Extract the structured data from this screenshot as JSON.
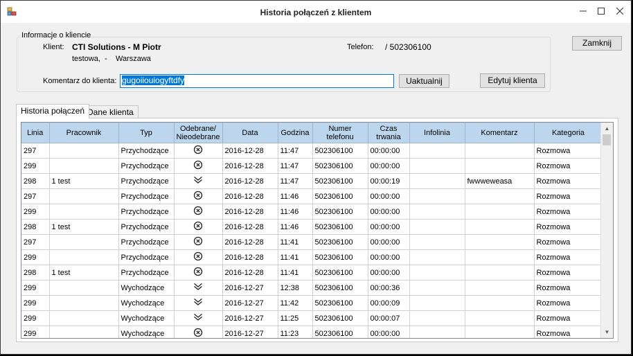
{
  "window": {
    "title": "Historia połączeń z klientem"
  },
  "client_info": {
    "group_label": "Informacje o kliencie",
    "client_label": "Klient:",
    "client_name": "CTI Solutions - M Piotr",
    "address": "testowa,  -    Warszawa",
    "phone_label": "Telefon:",
    "phone_value": "/ 502306100",
    "comment_label": "Komentarz do klienta:",
    "comment_value": "gugoiiouiogyftdfy"
  },
  "buttons": {
    "close": "Zamknij",
    "update": "Uaktualnij",
    "edit_client": "Edytuj klienta"
  },
  "tabs": [
    {
      "label": "Historia połączeń"
    },
    {
      "label": "Dane klienta"
    }
  ],
  "grid": {
    "columns": [
      {
        "label": "Linia"
      },
      {
        "label": "Pracownik"
      },
      {
        "label": "Typ"
      },
      {
        "label": "Odebrane/ Nieodebrane"
      },
      {
        "label": "Data"
      },
      {
        "label": "Godzina"
      },
      {
        "label": "Numer telefonu"
      },
      {
        "label": "Czas trwania"
      },
      {
        "label": "Infolinia"
      },
      {
        "label": "Komentarz"
      },
      {
        "label": "Kategoria"
      }
    ],
    "rows": [
      {
        "line": "297",
        "employee": "",
        "type": "Przychodzące",
        "status": "missed",
        "date": "2016-12-28",
        "time": "11:47",
        "phone": "502306100",
        "duration": "00:00:00",
        "hotline": "",
        "comment": "",
        "category": "Rozmowa"
      },
      {
        "line": "299",
        "employee": "",
        "type": "Przychodzące",
        "status": "missed",
        "date": "2016-12-28",
        "time": "11:47",
        "phone": "502306100",
        "duration": "00:00:00",
        "hotline": "",
        "comment": "",
        "category": "Rozmowa"
      },
      {
        "line": "298",
        "employee": "1 test",
        "type": "Przychodzące",
        "status": "answered",
        "date": "2016-12-28",
        "time": "11:47",
        "phone": "502306100",
        "duration": "00:00:19",
        "hotline": "",
        "comment": "fwwweweasa",
        "category": "Rozmowa"
      },
      {
        "line": "297",
        "employee": "",
        "type": "Przychodzące",
        "status": "missed",
        "date": "2016-12-28",
        "time": "11:46",
        "phone": "502306100",
        "duration": "00:00:00",
        "hotline": "",
        "comment": "",
        "category": "Rozmowa"
      },
      {
        "line": "299",
        "employee": "",
        "type": "Przychodzące",
        "status": "missed",
        "date": "2016-12-28",
        "time": "11:46",
        "phone": "502306100",
        "duration": "00:00:00",
        "hotline": "",
        "comment": "",
        "category": "Rozmowa"
      },
      {
        "line": "298",
        "employee": "1 test",
        "type": "Przychodzące",
        "status": "missed",
        "date": "2016-12-28",
        "time": "11:46",
        "phone": "502306100",
        "duration": "00:00:00",
        "hotline": "",
        "comment": "",
        "category": "Rozmowa"
      },
      {
        "line": "297",
        "employee": "",
        "type": "Przychodzące",
        "status": "missed",
        "date": "2016-12-28",
        "time": "11:41",
        "phone": "502306100",
        "duration": "00:00:00",
        "hotline": "",
        "comment": "",
        "category": "Rozmowa"
      },
      {
        "line": "299",
        "employee": "",
        "type": "Przychodzące",
        "status": "missed",
        "date": "2016-12-28",
        "time": "11:41",
        "phone": "502306100",
        "duration": "00:00:00",
        "hotline": "",
        "comment": "",
        "category": "Rozmowa"
      },
      {
        "line": "298",
        "employee": "1 test",
        "type": "Przychodzące",
        "status": "missed",
        "date": "2016-12-28",
        "time": "11:41",
        "phone": "502306100",
        "duration": "00:00:00",
        "hotline": "",
        "comment": "",
        "category": "Rozmowa"
      },
      {
        "line": "299",
        "employee": "",
        "type": "Wychodzące",
        "status": "answered",
        "date": "2016-12-27",
        "time": "12:38",
        "phone": "502306100",
        "duration": "00:00:36",
        "hotline": "",
        "comment": "",
        "category": "Rozmowa"
      },
      {
        "line": "299",
        "employee": "",
        "type": "Wychodzące",
        "status": "answered",
        "date": "2016-12-27",
        "time": "11:42",
        "phone": "502306100",
        "duration": "00:00:09",
        "hotline": "",
        "comment": "",
        "category": "Rozmowa"
      },
      {
        "line": "299",
        "employee": "",
        "type": "Wychodzące",
        "status": "answered",
        "date": "2016-12-27",
        "time": "11:25",
        "phone": "502306100",
        "duration": "00:00:07",
        "hotline": "",
        "comment": "",
        "category": "Rozmowa"
      },
      {
        "line": "299",
        "employee": "",
        "type": "Wychodzące",
        "status": "missed",
        "date": "2016-12-27",
        "time": "11:23",
        "phone": "502306100",
        "duration": "00:00:00",
        "hotline": "",
        "comment": "",
        "category": "Rozmowa"
      }
    ]
  },
  "colors": {
    "header_bg": "#bcd6ee",
    "selection": "#0078d7",
    "window_bg": "#f0f0f0"
  },
  "icons": {
    "missed": "circle-x-icon",
    "answered": "double-chevron-down-icon"
  }
}
